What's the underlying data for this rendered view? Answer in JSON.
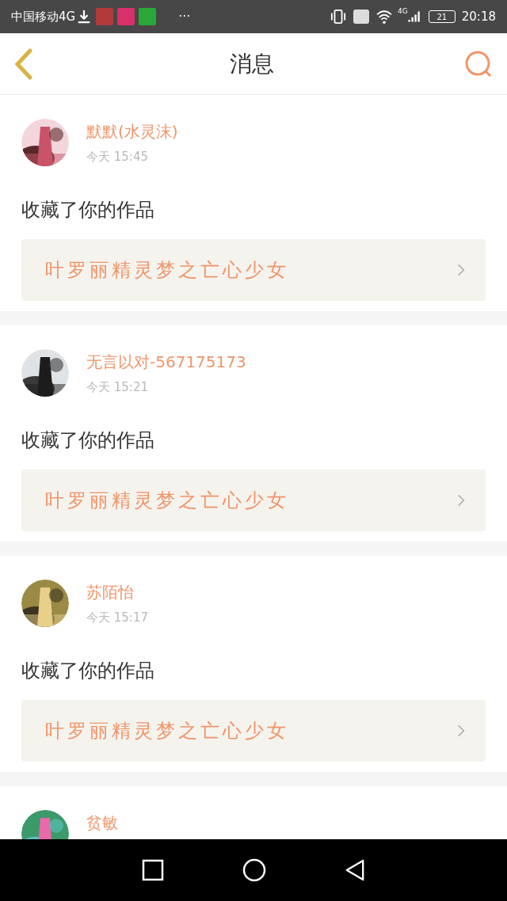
{
  "status_bar": {
    "carrier": "中国移动4G",
    "network": "4G",
    "battery": "21",
    "time": "20:18",
    "more": "···"
  },
  "header": {
    "title": "消息"
  },
  "messages": [
    {
      "name": "默默(水灵沫)",
      "time": "今天 15:45",
      "action": "收藏了你的作品",
      "work": "叶罗丽精灵梦之亡心少女",
      "kind": "picture"
    },
    {
      "name": "无言以对-567175173",
      "time": "今天 15:21",
      "action": "收藏了你的作品",
      "work": "叶罗丽精灵梦之亡心少女",
      "kind": "picture"
    },
    {
      "name": "苏陌怡",
      "time": "今天 15:17",
      "action": "收藏了你的作品",
      "work": "叶罗丽精灵梦之亡心少女",
      "kind": "picture"
    },
    {
      "name": "贫敏",
      "kind": "picture"
    }
  ]
}
